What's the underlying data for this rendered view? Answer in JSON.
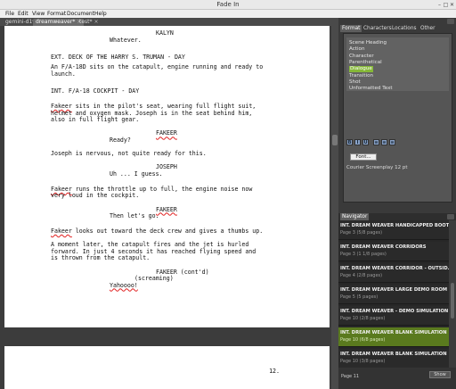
{
  "window": {
    "title": "Fade In"
  },
  "menu": [
    "File",
    "Edit",
    "View",
    "Format",
    "Document",
    "Help"
  ],
  "tabs": [
    {
      "label": "gemini-d1*",
      "active": false
    },
    {
      "label": "dreamweaver*",
      "active": true
    },
    {
      "label": "test*",
      "active": false
    }
  ],
  "script": {
    "lines": [
      {
        "text": "KALYN",
        "indent": 170,
        "row": 0,
        "sq": false
      },
      {
        "text": "Whatever.",
        "indent": 118,
        "row": 1,
        "sq": false
      },
      {
        "text": "EXT. DECK OF THE HARRY S. TRUMAN - DAY",
        "indent": 52,
        "row": 3.5,
        "sq": false
      },
      {
        "text": "An F/A-18D sits on the catapult, engine running and ready to",
        "indent": 52,
        "row": 5,
        "sq": false
      },
      {
        "text": "launch.",
        "indent": 52,
        "row": 6,
        "sq": false
      },
      {
        "text": "INT. F/A-18 COCKPIT - DAY",
        "indent": 52,
        "row": 8.5,
        "sq": false
      },
      {
        "text": "Fakeer sits in the pilot's seat, wearing full flight suit,",
        "indent": 52,
        "row": 10.8,
        "sq": true
      },
      {
        "text": "helmet and oxygen mask. Joseph is in the seat behind him,",
        "indent": 52,
        "row": 11.8,
        "sq": false
      },
      {
        "text": "also in full flight gear.",
        "indent": 52,
        "row": 12.8,
        "sq": false
      },
      {
        "text": "FAKEER",
        "indent": 170,
        "row": 14.8,
        "sq": true
      },
      {
        "text": "Ready?",
        "indent": 118,
        "row": 15.8,
        "sq": false
      },
      {
        "text": "Joseph is nervous, not quite ready for this.",
        "indent": 52,
        "row": 17.8,
        "sq": false
      },
      {
        "text": "JOSEPH",
        "indent": 170,
        "row": 19.8,
        "sq": false
      },
      {
        "text": "Uh ... I guess.",
        "indent": 118,
        "row": 20.8,
        "sq": false
      },
      {
        "text": "Fakeer runs the throttle up to full, the engine noise now",
        "indent": 52,
        "row": 23,
        "sq": true
      },
      {
        "text": "very loud in the cockpit.",
        "indent": 52,
        "row": 24,
        "sq": false
      },
      {
        "text": "FAKEER",
        "indent": 170,
        "row": 26,
        "sq": true
      },
      {
        "text": "Then let's go.",
        "indent": 118,
        "row": 27,
        "sq": false
      },
      {
        "text": "Fakeer looks out toward the deck crew and gives a thumbs up.",
        "indent": 52,
        "row": 29.2,
        "sq": true
      },
      {
        "text": "A moment later, the catapult fires and the jet is hurled",
        "indent": 52,
        "row": 31.2,
        "sq": false
      },
      {
        "text": "forward. In just 4 seconds it has reached flying speed and",
        "indent": 52,
        "row": 32.2,
        "sq": false
      },
      {
        "text": "is thrown from the catapult.",
        "indent": 52,
        "row": 33.2,
        "sq": false
      },
      {
        "text": "FAKEER (cont'd)",
        "indent": 170,
        "row": 35.2,
        "sq": false
      },
      {
        "text": "(screaming)",
        "indent": 146,
        "row": 36.2,
        "sq": false
      },
      {
        "text": "Yahoooo!",
        "indent": 118,
        "row": 37.2,
        "sq": true
      }
    ],
    "page_number": "12."
  },
  "side_tabs": [
    {
      "label": "Format",
      "active": true
    },
    {
      "label": "Characters",
      "active": false
    },
    {
      "label": "Locations",
      "active": false
    },
    {
      "label": "Other",
      "active": false
    }
  ],
  "elements": [
    {
      "label": "Scene Heading",
      "sel": false
    },
    {
      "label": "Action",
      "sel": false
    },
    {
      "label": "Character",
      "sel": false
    },
    {
      "label": "Parenthetical",
      "sel": false
    },
    {
      "label": "Dialogue",
      "sel": true
    },
    {
      "label": "Transition",
      "sel": false
    },
    {
      "label": "Shot",
      "sel": false
    },
    {
      "label": "Unformatted Text",
      "sel": false
    }
  ],
  "format_buttons": [
    {
      "label": "B",
      "name": "bold-button"
    },
    {
      "label": "I",
      "name": "italic-button"
    },
    {
      "label": "U",
      "name": "underline-button"
    },
    {
      "label": "≡",
      "name": "align-left-button"
    },
    {
      "label": "≡",
      "name": "align-center-button"
    },
    {
      "label": "≡",
      "name": "align-right-button"
    }
  ],
  "font": {
    "button_label": "Font...",
    "info": "Courier Screenplay 12 pt"
  },
  "navigator": {
    "title": "Navigator",
    "items": [
      {
        "heading": "INT. DREAM WEAVER HANDICAPPED BOOTH",
        "sub": "Page 3 (5/8 pages)",
        "sel": false
      },
      {
        "heading": "INT. DREAM WEAVER CORRIDORS",
        "sub": "Page 3 (1 1/8 pages)",
        "sel": false
      },
      {
        "heading": "INT. DREAM WEAVER CORRIDOR - OUTSID...",
        "sub": "Page 4 (2/8 pages)",
        "sel": false
      },
      {
        "heading": "INT. DREAM WEAVER LARGE DEMO ROOM",
        "sub": "Page 5 (5 pages)",
        "sel": false
      },
      {
        "heading": "INT. DREAM WEAVER - DEMO SIMULATION ...",
        "sub": "Page 10 (2/8 pages)",
        "sel": false
      },
      {
        "heading": "INT. DREAM WEAVER BLANK SIMULATION",
        "sub": "Page 10 (6/8 pages)",
        "sel": true
      },
      {
        "heading": "INT. DREAM WEAVER BLANK SIMULATION",
        "sub": "Page 10 (3/8 pages)",
        "sel": false
      }
    ],
    "page_indicator": "Page 11",
    "show_label": "Show"
  }
}
